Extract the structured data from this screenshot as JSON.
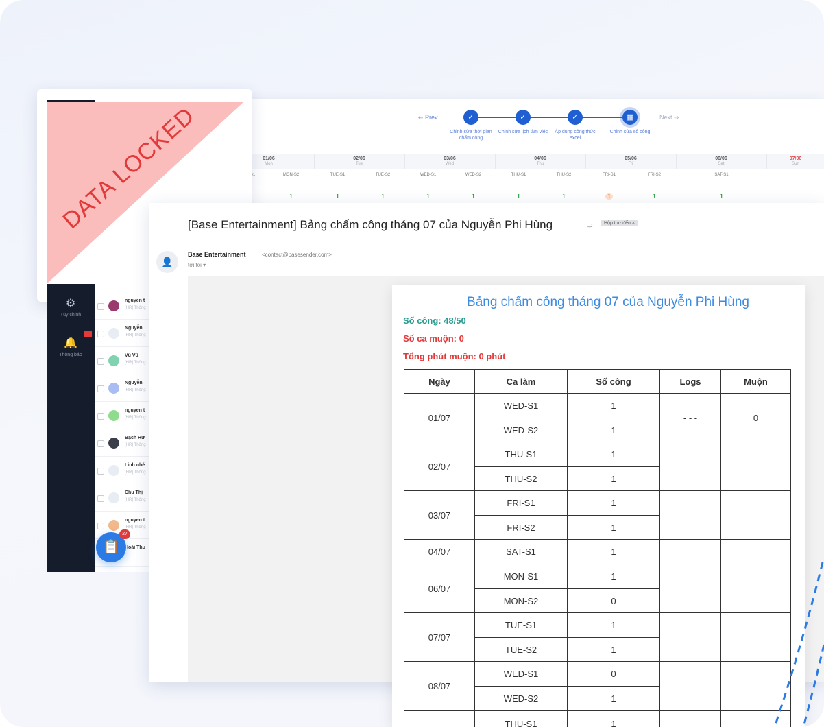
{
  "stepper": {
    "prev_label": "⇐ Prev",
    "next_label": "Next ⇒",
    "steps": [
      {
        "label": "Chỉnh sửa thời gian chấm công"
      },
      {
        "label": "Chỉnh sửa lịch làm việc"
      },
      {
        "label": "Áp dụng công thức excel"
      },
      {
        "label": "Chỉnh sửa số công"
      }
    ]
  },
  "week": {
    "days": [
      {
        "date": "01/06",
        "name": "Mon"
      },
      {
        "date": "02/06",
        "name": "Tue"
      },
      {
        "date": "03/06",
        "name": "Wed"
      },
      {
        "date": "04/06",
        "name": "Thu"
      },
      {
        "date": "05/06",
        "name": "Fri"
      },
      {
        "date": "06/06",
        "name": "Sat"
      },
      {
        "date": "07/06",
        "name": "Sun"
      }
    ],
    "shifts": [
      "MON-S1",
      "MON-S2",
      "TUE-S1",
      "TUE-S2",
      "WED-S1",
      "WED-S2",
      "THU-S1",
      "THU-S2",
      "FRI-S1",
      "FRI-S2",
      "SAT-S1"
    ],
    "values": [
      "1",
      "1",
      "1",
      "1",
      "1",
      "1",
      "1",
      "1",
      "1",
      "1",
      "1"
    ],
    "accent": "#e34b4b"
  },
  "locked_card": {
    "banner_text": "DATA LOCKED",
    "banner_color": "#fbbcbc",
    "text_color": "#e23a3a"
  },
  "sidebar": {
    "items": [
      {
        "icon": "gear-icon",
        "label": "Tùy chỉnh"
      },
      {
        "icon": "bell-icon",
        "label": "Thông báo"
      }
    ]
  },
  "inbox_list": {
    "items": [
      {
        "name": "nguyen t",
        "sub": "[HR] Thông"
      },
      {
        "name": "Nguyễn",
        "sub": "[HR] Thông"
      },
      {
        "name": "Vũ Vũ",
        "sub": "[HR] Thông"
      },
      {
        "name": "Nguyễn",
        "sub": "[HR] Thông"
      },
      {
        "name": "nguyen t",
        "sub": "[HR] Thông"
      },
      {
        "name": "Bạch Hư",
        "sub": "[HR] Thông"
      },
      {
        "name": "Linh nhé",
        "sub": "[HR] Thông"
      },
      {
        "name": "Chu Thị",
        "sub": "[HR] Thông"
      },
      {
        "name": "nguyen t",
        "sub": "[HR] Thông"
      },
      {
        "name": "Hoài Thu",
        "sub": ""
      }
    ],
    "fab_badge": "27"
  },
  "email": {
    "subject": "[Base Entertainment] Bảng chấm công tháng 07 của Nguyễn Phi Hùng",
    "inbox_chip": "Hộp thư đến ×",
    "sender_name": "Base Entertainment",
    "sender_email": "<contact@basesender.com>",
    "recipient": "tới tôi ▾"
  },
  "report": {
    "title": "Bảng chấm công tháng 07 của Nguyễn Phi Hùng",
    "so_cong": "Số công: 48/50",
    "so_ca_muon": "Số ca muộn: 0",
    "tong_phut_muon": "Tổng phút muộn: 0 phút",
    "headers": [
      "Ngày",
      "Ca làm",
      "Số công",
      "Logs",
      "Muộn"
    ],
    "groups": [
      {
        "date": "01/07",
        "shifts": [
          {
            "name": "WED-S1",
            "value": "1"
          },
          {
            "name": "WED-S2",
            "value": "1"
          }
        ],
        "logs": "- - -",
        "late": "0"
      },
      {
        "date": "02/07",
        "shifts": [
          {
            "name": "THU-S1",
            "value": "1"
          },
          {
            "name": "THU-S2",
            "value": "1"
          }
        ],
        "logs": "",
        "late": ""
      },
      {
        "date": "03/07",
        "shifts": [
          {
            "name": "FRI-S1",
            "value": "1"
          },
          {
            "name": "FRI-S2",
            "value": "1"
          }
        ],
        "logs": "",
        "late": ""
      },
      {
        "date": "04/07",
        "shifts": [
          {
            "name": "SAT-S1",
            "value": "1"
          }
        ],
        "logs": "",
        "late": ""
      },
      {
        "date": "06/07",
        "shifts": [
          {
            "name": "MON-S1",
            "value": "1"
          },
          {
            "name": "MON-S2",
            "value": "0"
          }
        ],
        "logs": "",
        "late": ""
      },
      {
        "date": "07/07",
        "shifts": [
          {
            "name": "TUE-S1",
            "value": "1"
          },
          {
            "name": "TUE-S2",
            "value": "1"
          }
        ],
        "logs": "",
        "late": ""
      },
      {
        "date": "08/07",
        "shifts": [
          {
            "name": "WED-S1",
            "value": "0"
          },
          {
            "name": "WED-S2",
            "value": "1"
          }
        ],
        "logs": "",
        "late": ""
      },
      {
        "date": "",
        "shifts": [
          {
            "name": "THU-S1",
            "value": "1"
          }
        ],
        "logs": "",
        "late": ""
      }
    ],
    "colors": {
      "title": "#3d8be0",
      "teal": "#2a9b8f",
      "red": "#e23a3a"
    }
  }
}
